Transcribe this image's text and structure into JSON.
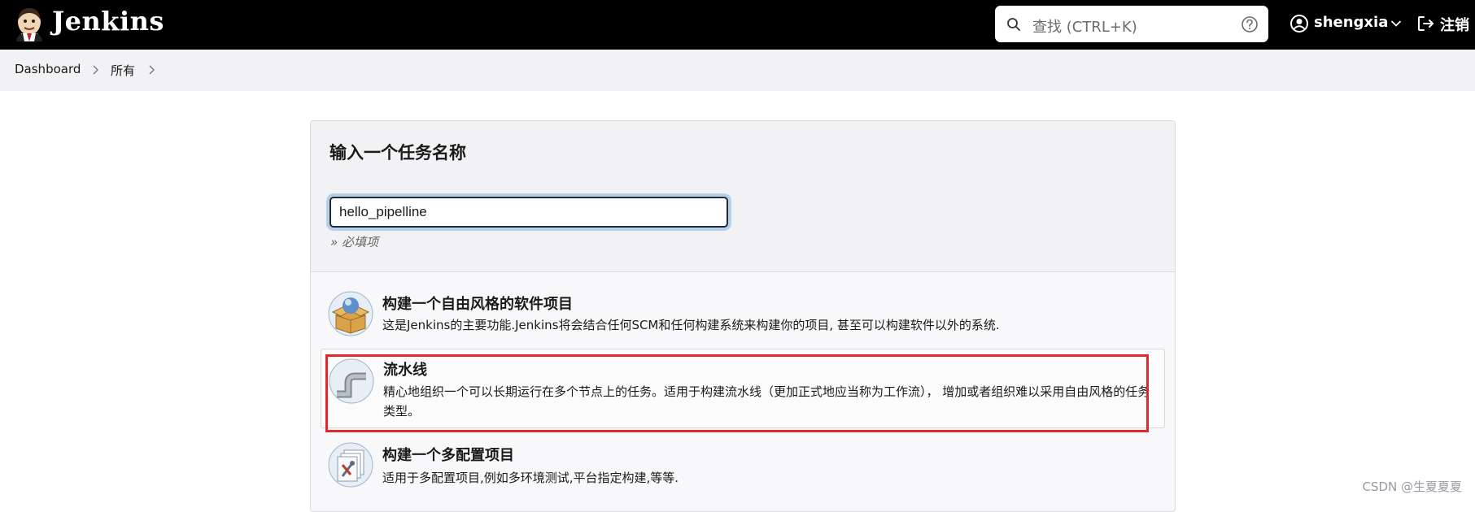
{
  "header": {
    "brand": "Jenkins",
    "search": {
      "placeholder": "查找 (CTRL+K)"
    },
    "user": {
      "name": "shengxia"
    },
    "logout_label": "注销"
  },
  "breadcrumb": [
    {
      "label": "Dashboard"
    },
    {
      "label": "所有"
    }
  ],
  "new_item": {
    "title": "输入一个任务名称",
    "name_value": "hello_pipelline",
    "required_hint": "» 必填项"
  },
  "items": [
    {
      "title": "构建一个自由风格的软件项目",
      "description": "这是Jenkins的主要功能.Jenkins将会结合任何SCM和任何构建系统来构建你的项目, 甚至可以构建软件以外的系统.",
      "icon": "freestyle-project-icon"
    },
    {
      "title": "流水线",
      "description": "精心地组织一个可以长期运行在多个节点上的任务。适用于构建流水线（更加正式地应当称为工作流）， 增加或者组织难以采用自由风格的任务类型。",
      "icon": "pipeline-icon",
      "selected": true
    },
    {
      "title": "构建一个多配置项目",
      "description": "适用于多配置项目,例如多环境测试,平台指定构建,等等.",
      "icon": "multi-config-project-icon"
    }
  ],
  "watermark": "CSDN @生夏夏夏",
  "colors": {
    "header_bg": "#000000",
    "breadcrumb_bg": "#f2f2f5",
    "highlight": "#e0282e",
    "focus_ring": "#b7d0e8"
  }
}
